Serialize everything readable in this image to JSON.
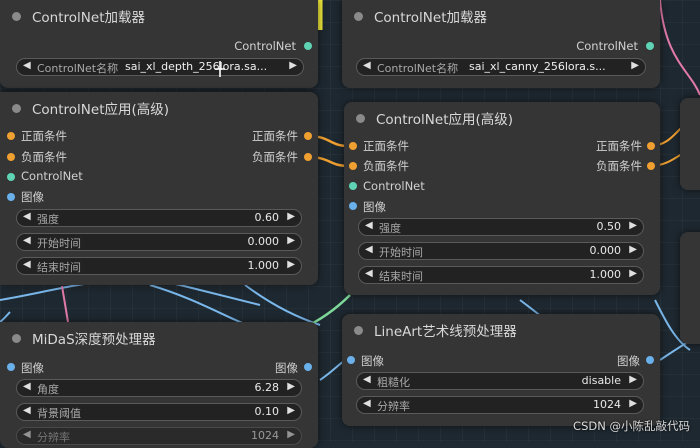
{
  "colors": {
    "canvas_bg": "#1e2830",
    "node_bg": "#353535",
    "conditioning_port": "#f0a030",
    "controlnet_port": "#5fd4b4",
    "image_port": "#6ab0ea",
    "wire_blue": "#7ab8ec",
    "wire_pink": "#e27aa8",
    "wire_green": "#7fd99a",
    "wire_yellow": "#f2ea3a"
  },
  "loader_left": {
    "title": "ControlNet加载器",
    "output_label": "ControlNet",
    "model_name_label": "ControlNet名称",
    "model_name_value": "sai_xl_depth_256lora.sa..."
  },
  "loader_right": {
    "title": "ControlNet加载器",
    "output_label": "ControlNet",
    "model_name_label": "ControlNet名称",
    "model_name_value": "sai_xl_canny_256lora.s..."
  },
  "apply_left": {
    "title": "ControlNet应用(高级)",
    "in_positive": "正面条件",
    "in_negative": "负面条件",
    "in_controlnet": "ControlNet",
    "in_image": "图像",
    "out_positive": "正面条件",
    "out_negative": "负面条件",
    "strength_label": "强度",
    "strength_value": "0.60",
    "start_label": "开始时间",
    "start_value": "0.000",
    "end_label": "结束时间",
    "end_value": "1.000"
  },
  "apply_right": {
    "title": "ControlNet应用(高级)",
    "in_positive": "正面条件",
    "in_negative": "负面条件",
    "in_controlnet": "ControlNet",
    "in_image": "图像",
    "out_positive": "正面条件",
    "out_negative": "负面条件",
    "strength_label": "强度",
    "strength_value": "0.50",
    "start_label": "开始时间",
    "start_value": "0.000",
    "end_label": "结束时间",
    "end_value": "1.000"
  },
  "midas": {
    "title": "MiDaS深度预处理器",
    "in_image": "图像",
    "out_image": "图像",
    "angle_label": "角度",
    "angle_value": "6.28",
    "bg_label": "背景阈值",
    "bg_value": "0.10",
    "res_label": "分辨率",
    "res_value": "1024"
  },
  "lineart": {
    "title": "LineArt艺术线预处理器",
    "in_image": "图像",
    "out_image": "图像",
    "coarse_label": "粗糙化",
    "coarse_value": "disable",
    "res_label": "分辨率",
    "res_value": "1024"
  },
  "arrows": {
    "left": "◀",
    "right": "▶"
  },
  "watermark": "CSDN @小陈乱敲代码"
}
